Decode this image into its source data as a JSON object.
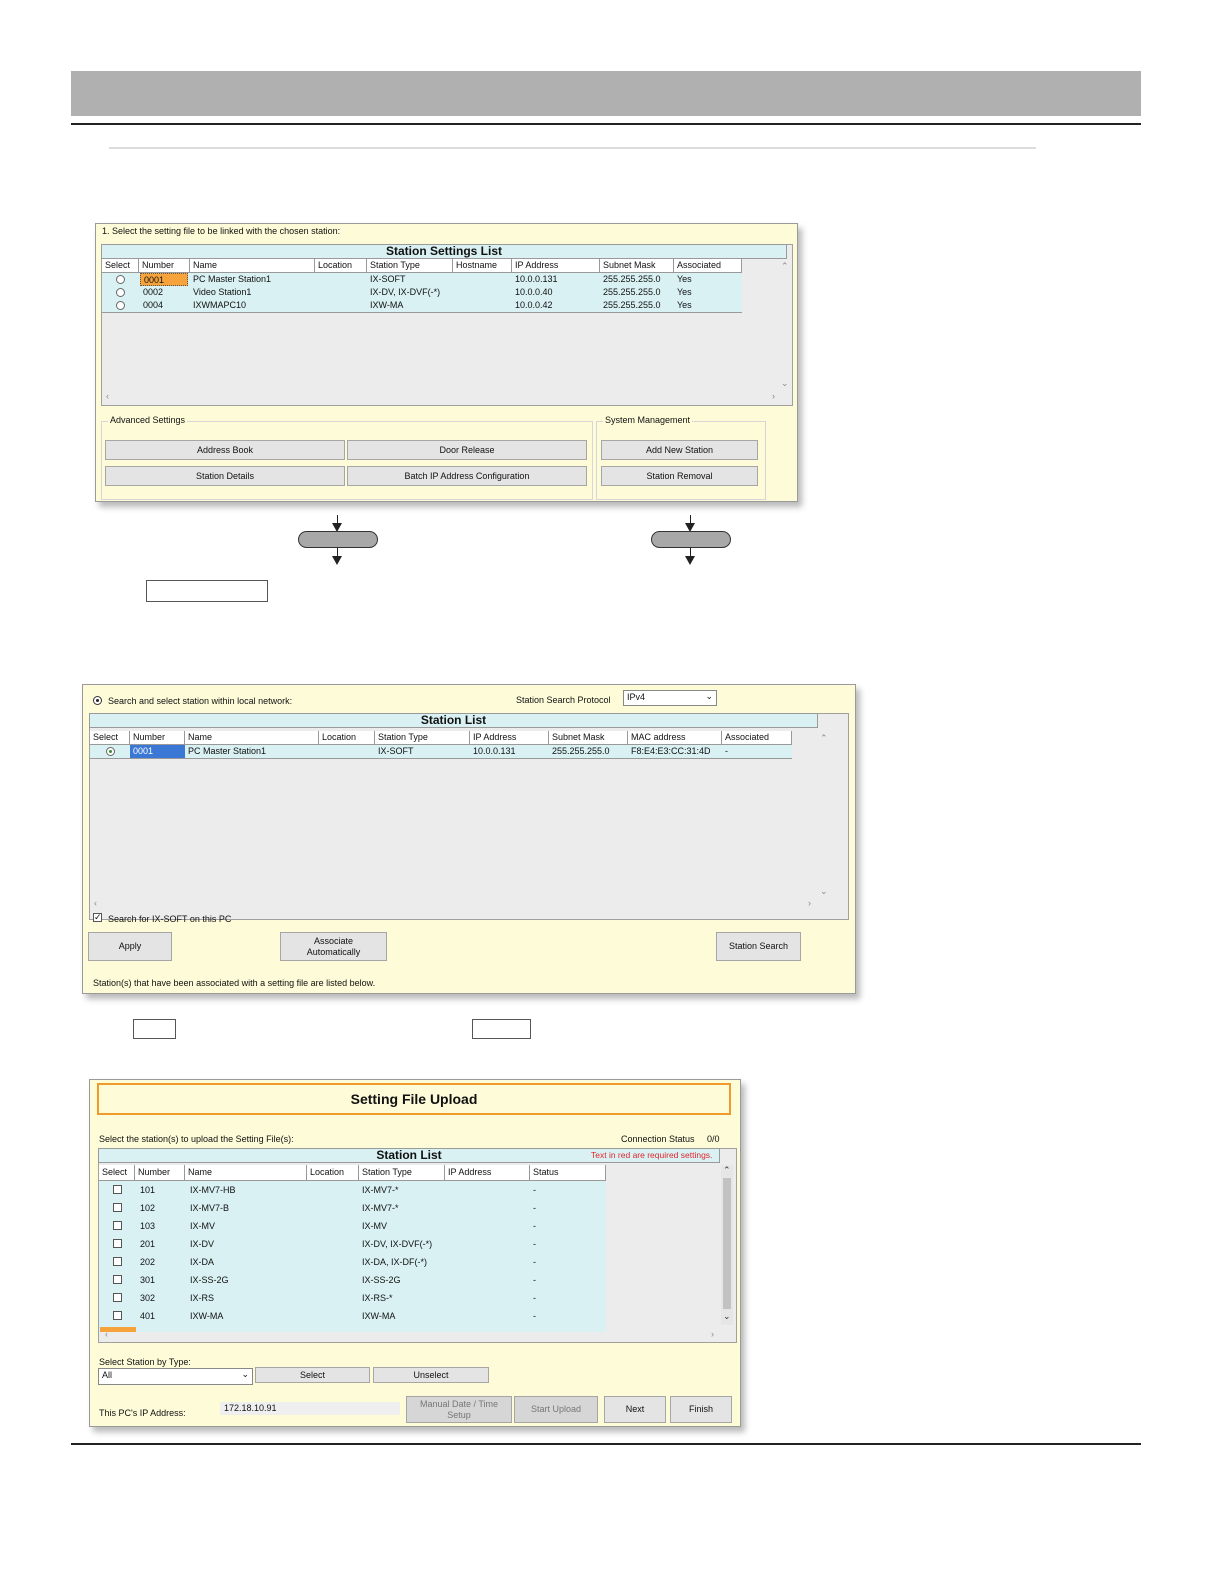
{
  "window1": {
    "instruction": "1. Select the setting file to be linked with the chosen station:",
    "table_title": "Station Settings List",
    "columns": [
      "Select",
      "Number",
      "Name",
      "Location",
      "Station Type",
      "Hostname",
      "IP Address",
      "Subnet Mask",
      "Associated"
    ],
    "rows": [
      {
        "number": "0001",
        "name": "PC Master Station1",
        "location": "",
        "type": "IX-SOFT",
        "hostname": "",
        "ip": "10.0.0.131",
        "mask": "255.255.255.0",
        "assoc": "Yes"
      },
      {
        "number": "0002",
        "name": "Video Station1",
        "location": "",
        "type": "IX-DV, IX-DVF(-*)",
        "hostname": "",
        "ip": "10.0.0.40",
        "mask": "255.255.255.0",
        "assoc": "Yes"
      },
      {
        "number": "0004",
        "name": "IXWMAPC10",
        "location": "",
        "type": "IXW-MA",
        "hostname": "",
        "ip": "10.0.0.42",
        "mask": "255.255.255.0",
        "assoc": "Yes"
      }
    ],
    "advanced_settings": {
      "label": "Advanced Settings",
      "address_book": "Address Book",
      "door_release": "Door Release",
      "station_details": "Station Details",
      "batch_ip": "Batch IP Address Configuration"
    },
    "system_management": {
      "label": "System Management",
      "add_new_station": "Add New Station",
      "station_removal": "Station Removal"
    }
  },
  "window2": {
    "search_option": "Search and select station within local network:",
    "protocol_label": "Station Search Protocol",
    "protocol_value": "IPv4",
    "table_title": "Station List",
    "columns": [
      "Select",
      "Number",
      "Name",
      "Location",
      "Station Type",
      "IP Address",
      "Subnet Mask",
      "MAC address",
      "Associated"
    ],
    "rows": [
      {
        "number": "0001",
        "name": "PC Master Station1",
        "location": "",
        "type": "IX-SOFT",
        "ip": "10.0.0.131",
        "mask": "255.255.255.0",
        "mac": "F8:E4:E3:CC:31:4D",
        "assoc": "-"
      }
    ],
    "search_pc_label": "Search for IX-SOFT on this PC",
    "apply": "Apply",
    "associate_line1": "Associate",
    "associate_line2": "Automatically",
    "station_search": "Station Search",
    "footer_note": "Station(s) that have been associated with a setting file are listed below."
  },
  "window3": {
    "title": "Setting File Upload",
    "instruction": "Select the station(s) to upload the Setting File(s):",
    "connection_status_label": "Connection Status",
    "connection_status_value": "0/0",
    "table_title": "Station List",
    "required_note": "Text in red are required settings.",
    "columns": [
      "Select",
      "Number",
      "Name",
      "Location",
      "Station Type",
      "IP Address",
      "Status"
    ],
    "rows": [
      {
        "number": "101",
        "name": "IX-MV7-HB",
        "type": "IX-MV7-*",
        "status": "-"
      },
      {
        "number": "102",
        "name": "IX-MV7-B",
        "type": "IX-MV7-*",
        "status": "-"
      },
      {
        "number": "103",
        "name": "IX-MV",
        "type": "IX-MV",
        "status": "-"
      },
      {
        "number": "201",
        "name": "IX-DV",
        "type": "IX-DV, IX-DVF(-*)",
        "status": "-"
      },
      {
        "number": "202",
        "name": "IX-DA",
        "type": "IX-DA, IX-DF(-*)",
        "status": "-"
      },
      {
        "number": "301",
        "name": "IX-SS-2G",
        "type": "IX-SS-2G",
        "status": "-"
      },
      {
        "number": "302",
        "name": "IX-RS",
        "type": "IX-RS-*",
        "status": "-"
      },
      {
        "number": "401",
        "name": "IXW-MA",
        "type": "IXW-MA",
        "status": "-"
      }
    ],
    "select_by_type_label": "Select Station by Type:",
    "select_by_type_value": "All",
    "select_btn": "Select",
    "unselect_btn": "Unselect",
    "pc_ip_label": "This PC's IP Address:",
    "pc_ip_value": "172.18.10.91",
    "manual_date_line1": "Manual Date / Time",
    "manual_date_line2": "Setup",
    "start_upload": "Start Upload",
    "next": "Next",
    "finish": "Finish"
  },
  "colors": {
    "window_bg": "#fdfbd8",
    "table_row": "#d9f1f3",
    "selected_number": "#f7a33c",
    "highlight_blue": "#3b78d6",
    "title_border": "#f09a2c",
    "required_red": "#e0252b",
    "header_bar": "#b0b0b0"
  }
}
